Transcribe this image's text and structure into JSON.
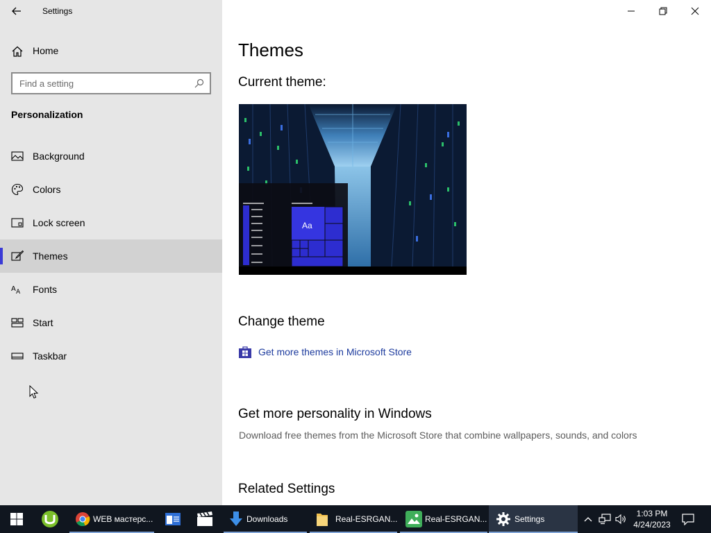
{
  "window": {
    "title": "Settings",
    "controls": {
      "minimize": "minimize-icon",
      "restore": "restore-icon",
      "close": "close-icon"
    }
  },
  "sidebar": {
    "home_label": "Home",
    "search_placeholder": "Find a setting",
    "section_heading": "Personalization",
    "items": [
      {
        "label": "Background",
        "icon": "picture-icon"
      },
      {
        "label": "Colors",
        "icon": "palette-icon"
      },
      {
        "label": "Lock screen",
        "icon": "lock-screen-icon"
      },
      {
        "label": "Themes",
        "icon": "brush-icon",
        "selected": true
      },
      {
        "label": "Fonts",
        "icon": "font-icon"
      },
      {
        "label": "Start",
        "icon": "start-layout-icon"
      },
      {
        "label": "Taskbar",
        "icon": "taskbar-icon"
      }
    ]
  },
  "main": {
    "title": "Themes",
    "current_theme_heading": "Current theme:",
    "preview_tile_text": "Aa",
    "change_theme_heading": "Change theme",
    "store_link": "Get more themes in Microsoft Store",
    "personality_heading": "Get more personality in Windows",
    "personality_desc": "Download free themes from the Microsoft Store that combine wallpapers, sounds, and colors",
    "related_heading": "Related Settings"
  },
  "taskbar": {
    "items": [
      {
        "label": "",
        "icon": "windows-start-icon"
      },
      {
        "label": "",
        "icon": "utorrent-icon"
      },
      {
        "label": "WEB мастерс...",
        "icon": "chrome-icon"
      },
      {
        "label": "",
        "icon": "app-window-icon"
      },
      {
        "label": "",
        "icon": "clapperboard-icon"
      },
      {
        "label": "Downloads",
        "icon": "download-arrow-icon"
      },
      {
        "label": "Real-ESRGAN...",
        "icon": "folder-icon"
      },
      {
        "label": "Real-ESRGAN...",
        "icon": "image-viewer-icon"
      },
      {
        "label": "Settings",
        "icon": "gear-icon",
        "active": true
      }
    ],
    "time": "1:03 PM",
    "date": "4/24/2023"
  },
  "colors": {
    "accent": "#3a3ad6",
    "link": "#1e3c9e",
    "sidebar_bg": "#e6e6e6",
    "taskbar_bg": "#10161f"
  }
}
